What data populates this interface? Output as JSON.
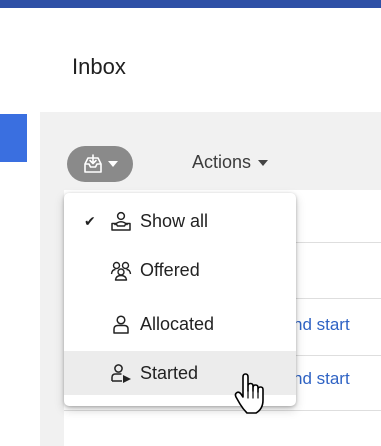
{
  "page": {
    "title": "Inbox"
  },
  "toolbar": {
    "filter_icon": "inbox-filter-icon",
    "actions_label": "Actions"
  },
  "background_rows": [
    {
      "text": "nd start"
    },
    {
      "text": "nd start"
    }
  ],
  "filter_menu": {
    "items": [
      {
        "label": "Show all",
        "icon": "show-all-icon",
        "checked": true
      },
      {
        "label": "Offered",
        "icon": "offered-icon",
        "checked": false
      },
      {
        "label": "Allocated",
        "icon": "allocated-icon",
        "checked": false
      },
      {
        "label": "Started",
        "icon": "started-icon",
        "checked": false,
        "hovered": true
      }
    ],
    "check_glyph": "✔"
  },
  "colors": {
    "top_bar": "#2e50a6",
    "link": "#2f63c4",
    "filter_button": "#8a8a8a",
    "hover": "#ececec"
  }
}
